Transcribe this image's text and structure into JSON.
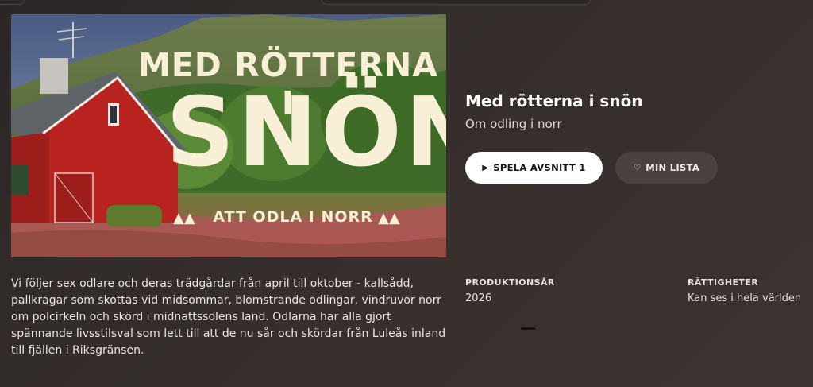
{
  "hero": {
    "title_top": "MED RÖTTERNA I",
    "title_big": "SNÖN",
    "subtitle": "ATT ODLA I NORR"
  },
  "show": {
    "title": "Med rötterna i snön",
    "subtitle": "Om odling i norr",
    "description": "Vi följer sex odlare och deras trädgårdar från april till oktober - kallsådd, pallkragar som skottas vid midsommar, blomstrande odlingar, vindruvor norr om polcirkeln och skörd i midnattssolens land. Odlarna har alla gjort spännande livsstilsval som lett till att de nu sår och skördar från Luleås inland till fjällen i Riksgränsen."
  },
  "actions": {
    "play_label": "SPELA AVSNITT 1",
    "play_icon": "play-icon",
    "list_label": "MIN LISTA",
    "list_icon": "heart-icon"
  },
  "meta": {
    "production_year_label": "PRODUKTIONSÅR",
    "production_year": "2026",
    "rights_label": "RÄTTIGHETER",
    "rights": "Kan ses i hela världen"
  },
  "colors": {
    "background": "#2b2626",
    "title_text": "#f7efd6",
    "barn_red": "#b8231f",
    "play_button": "#ffffff",
    "list_button": "#4a4240"
  }
}
